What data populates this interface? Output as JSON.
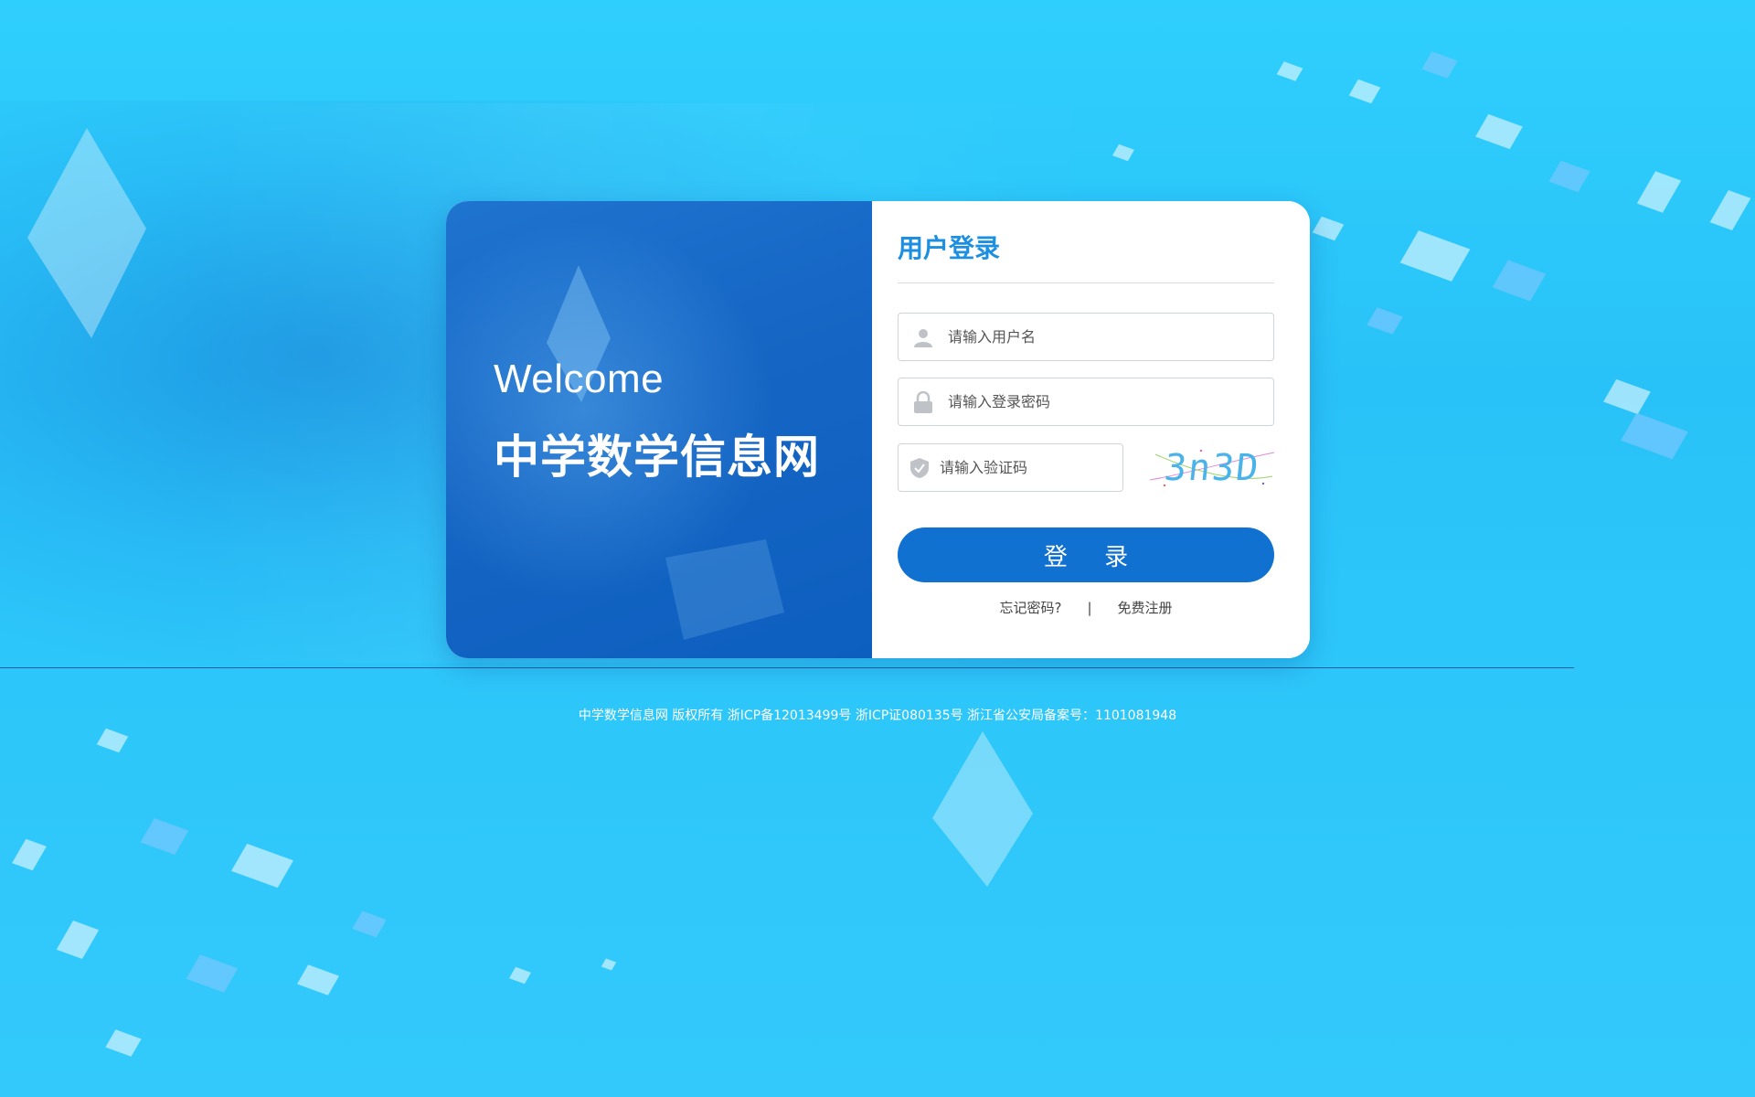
{
  "banner": {
    "welcome": "Welcome",
    "site_name": "中学数学信息网"
  },
  "login": {
    "title": "用户登录",
    "username_placeholder": "请输入用户名",
    "password_placeholder": "请输入登录密码",
    "captcha_placeholder": "请输入验证码",
    "captcha_text": "3n3D",
    "submit_label": "登 录",
    "forgot_link": "忘记密码?",
    "separator": "|",
    "register_link": "免费注册"
  },
  "footer": {
    "text": "中学数学信息网  版权所有 浙ICP备12013499号 浙ICP证080135号 浙江省公安局备案号：1101081948"
  },
  "colors": {
    "accent": "#1071d0",
    "title": "#1d8fe0",
    "background": "#2fcffd"
  },
  "icons": {
    "username": "user-icon",
    "password": "lock-icon",
    "captcha": "shield-icon"
  }
}
